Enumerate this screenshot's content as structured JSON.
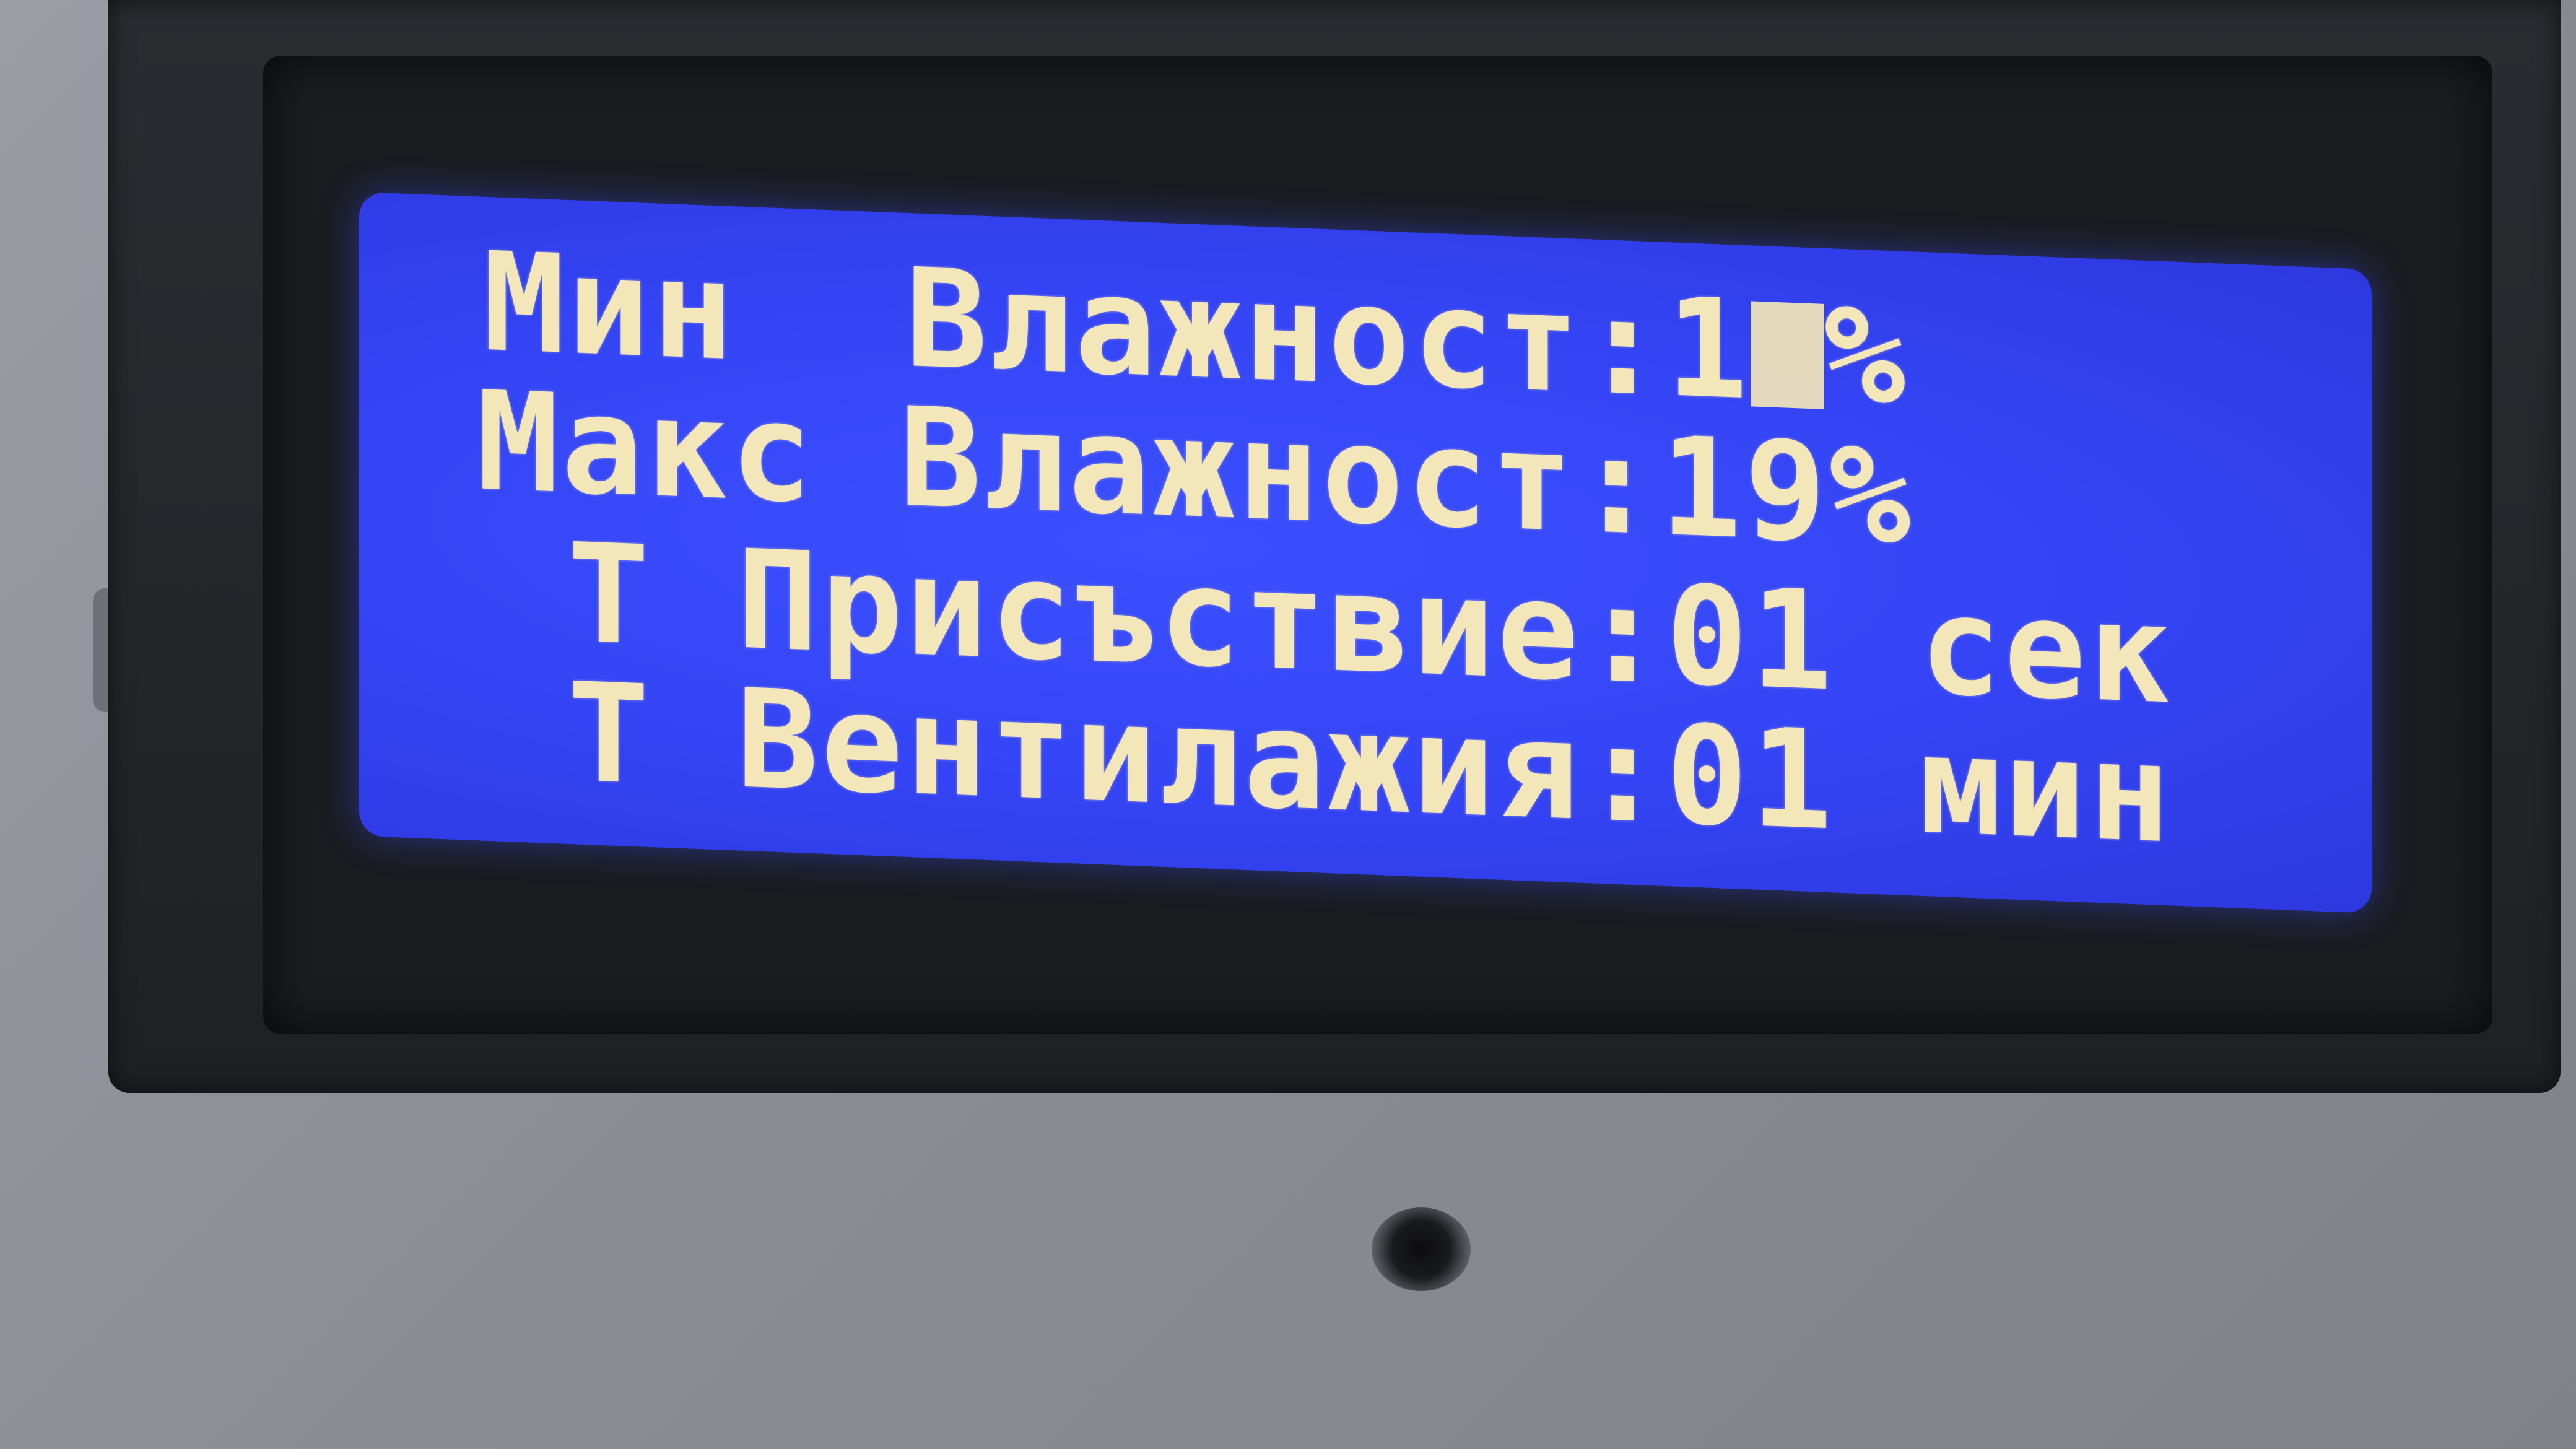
{
  "display": {
    "rows": [
      {
        "label": "Мин  Влажност:",
        "value_prefix": "1",
        "value_suffix": "%",
        "cursor": true
      },
      {
        "label": "Макс Влажност:",
        "value": "19%"
      },
      {
        "label": " Т Присъствие:",
        "value": "01",
        "unit": " сек"
      },
      {
        "label": " Т Вентилажия:",
        "value": "01",
        "unit": " мин"
      }
    ],
    "text_color": "#f3e6b8",
    "backlight_color": "#3444f4"
  },
  "housing_color": "#8a8e94",
  "bezel_color": "#24262a"
}
